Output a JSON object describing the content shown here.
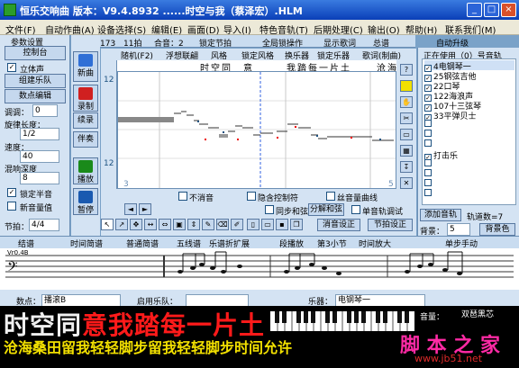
{
  "window": {
    "title": "恒乐交响曲 版本：V9.4.8932 ......时空与我（蔡泽宏）.HLM",
    "minimize": "_",
    "maximize": "□",
    "close": "×"
  },
  "menu": [
    "文件(F)",
    "自动作曲(A)",
    "设备选择(S)",
    "编辑(E)",
    "画面(D)",
    "导入(I)",
    "特色音轨(T)",
    "后期处理(C)",
    "输出(O)",
    "帮助(H)",
    "联系我们(M)"
  ],
  "left": {
    "group_title": "参数设置",
    "control": "控制台",
    "stereo": "立体声",
    "stereo_checked": "✓",
    "orchestra": "组建乐队",
    "numeric_edit": "数点编辑",
    "key_label": "调调：",
    "key_value": "0",
    "rhythm_label": "旋律长度：",
    "rhythm_value": "1/2",
    "speed_label": "速度：",
    "speed_value": "40",
    "depth_label": "混响深度",
    "depth_value": "8",
    "lock_half": "锁定半音",
    "lock_half_checked": "✓",
    "new_volume": "新音量值",
    "tempo_label": "节拍：",
    "tempo_value": "4/4"
  },
  "tools": {
    "new": "新曲",
    "record": "录制",
    "continue": "续录",
    "accompany": "伴奏",
    "play": "播放",
    "pause": "暂停"
  },
  "status": {
    "position": "定位：173",
    "bar": "11拍",
    "voice": "合音：2",
    "lock_beat": "锁定节拍",
    "full_measure": "全局锁操作",
    "show_lyrics": "显示歌词",
    "group": "总谱",
    "auto_upgrade": "自动升级"
  },
  "editor": {
    "random": "随机(F2)",
    "float_edit": "浮想联翩",
    "style": "风格",
    "lock_style": "锁定风格",
    "change_instrument": "换乐器",
    "lock_instrument": "锁定乐器",
    "lyrics_edit": "歌词(制曲)",
    "lyrics_top": [
      "时",
      "空",
      "同",
      "意",
      "我",
      "踏",
      "每",
      "一",
      "片",
      "土",
      "沧",
      "海"
    ],
    "no_reverb": "不消音",
    "hidden_control": "隐含控制符",
    "lyric_curve": "丝音量曲线",
    "sync_harmony": "同步和弦",
    "split_harmony": "分解和弦",
    "single_track_test": "单音轨调试",
    "reverb_settings": "消音设正",
    "beat_settings": "节拍设正",
    "ruler_num": "12",
    "marker_3": "3",
    "marker_5": "5"
  },
  "tracks": {
    "title": "正在使用（0）号音轨",
    "items": [
      "4电钢琴一",
      "25钢弦吉他",
      "22口琴",
      "122海浪声",
      "107十三弦琴",
      "33平弹贝士",
      "",
      "",
      "",
      "打击乐",
      "",
      "",
      "",
      "",
      ""
    ],
    "add": "添加音轨",
    "track_count": "轨道数=7",
    "bg_label": "背景：",
    "bg_value": "5",
    "bg_color": "背景色"
  },
  "scorebar": {
    "staff": "结谱",
    "simple": "时间简谱",
    "normal": "普通简谱",
    "five_line": "五线谱",
    "expand": "乐谱折扩展",
    "segment_play": "段播放",
    "section": "第3小节",
    "time_zoom": "时间放大",
    "single_step": "单步手动",
    "clef": "Vr0.4B"
  },
  "ctrlbar": {
    "numeric": "数点：",
    "numeric_value": "播滚B",
    "enable_band": "启用乐队：",
    "band_value": "",
    "instrument_label": "乐器：",
    "instrument_value": "电钢琴一",
    "volume_label": "音量：",
    "chord_pro": "双琶黑芯"
  },
  "karaoke": {
    "line1_sung": "意我踏每一片土",
    "line1_unsung_prefix": "时空同",
    "line2": "沧海桑田留我轻轻脚步留我轻轻脚步时间允许"
  },
  "watermark": {
    "cn": "脚 本 之 家",
    "url": "www.jb51.net"
  },
  "colors": {
    "titlebar": "#0a3fb8",
    "panel": "#d4e3f3",
    "sung": "#ff1a1a",
    "lyric_yellow": "#f2e000"
  }
}
